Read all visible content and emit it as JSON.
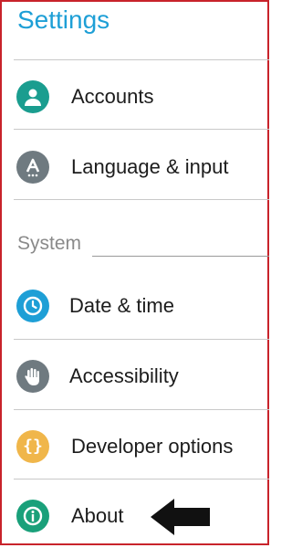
{
  "title": "Settings",
  "items": [
    {
      "label": "Accounts",
      "icon": "account-icon",
      "color": "#1a9d8f"
    },
    {
      "label": "Language & input",
      "icon": "language-icon",
      "color": "#6f7a80"
    }
  ],
  "section": "System",
  "system_items": [
    {
      "label": "Date & time",
      "icon": "clock-icon",
      "color": "#1e9fd6"
    },
    {
      "label": "Accessibility",
      "icon": "hand-icon",
      "color": "#6f7a80"
    },
    {
      "label": "Developer options",
      "icon": "braces-icon",
      "color": "#f0b64a"
    },
    {
      "label": "About",
      "icon": "info-icon",
      "color": "#1aa07a"
    }
  ]
}
